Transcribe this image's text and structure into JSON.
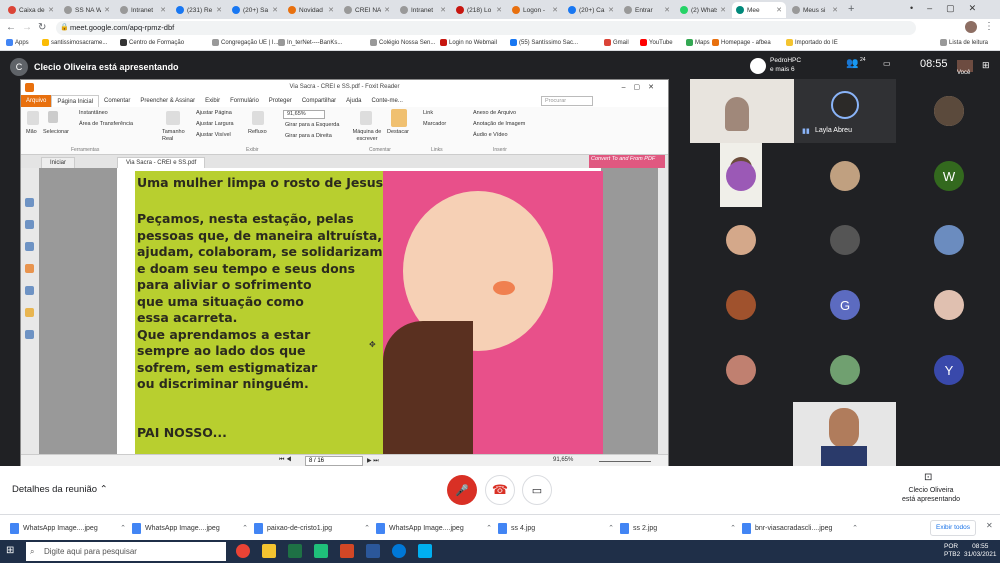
{
  "browser": {
    "tabs": [
      {
        "label": "Caixa de",
        "color": "#db4437"
      },
      {
        "label": "SS NA W",
        "color": "#999999"
      },
      {
        "label": "Intranet",
        "color": "#999999"
      },
      {
        "label": "(231) Re",
        "color": "#1877f2"
      },
      {
        "label": "(20+) Sa",
        "color": "#1877f2"
      },
      {
        "label": "Novidad",
        "color": "#e8700e"
      },
      {
        "label": "CREI NA",
        "color": "#999999"
      },
      {
        "label": "Intranet",
        "color": "#999999"
      },
      {
        "label": "(218) Lo",
        "color": "#c71610"
      },
      {
        "label": "Logon -",
        "color": "#e8700e"
      },
      {
        "label": "(20+) Ca",
        "color": "#1877f2"
      },
      {
        "label": "Entrar",
        "color": "#999999"
      },
      {
        "label": "(2) Whats",
        "color": "#25d366"
      },
      {
        "label": "Mee",
        "color": "#00897b",
        "active": true
      },
      {
        "label": "Meus si",
        "color": "#999999"
      }
    ],
    "url": "meet.google.com/apq-rpmz-dbf",
    "bookmarks": [
      "Apps",
      "santissimosacrame...",
      "Centro de Formação",
      "Congregação UE | I...",
      "In_terNet----BanKs...",
      "Colégio Nossa Sen...",
      "Login no Webmail",
      "(55) Santíssimo Sac...",
      "Gmail",
      "YouTube",
      "Maps",
      "Homepage - afbea",
      "Importado do IE",
      "Lista de leitura"
    ]
  },
  "meet": {
    "presenter_initial": "C",
    "presenter_text": "Clecio Oliveira está apresentando",
    "top_right_name": "PedroHPC",
    "top_right_more": "e mais 6",
    "participants_count": "24",
    "time": "08:55",
    "you_label": "Você",
    "speaker_name": "Layla Abreu",
    "meeting_details": "Detalhes da reunião",
    "presenting_name": "Clecio Oliveira",
    "presenting_label": "está apresentando",
    "participants": [
      {
        "kind": "photo",
        "color": "#c8b8a0"
      },
      {
        "kind": "photo",
        "color": "#5b4a3c"
      },
      {
        "kind": "photo",
        "color": "#9b59b6"
      },
      {
        "kind": "photo",
        "color": "#c0a080"
      },
      {
        "kind": "letter",
        "letter": "W",
        "color": "#33691e"
      },
      {
        "kind": "photo",
        "color": "#d4a88a"
      },
      {
        "kind": "photo",
        "color": "#555555"
      },
      {
        "kind": "photo",
        "color": "#6b8cbf"
      },
      {
        "kind": "photo",
        "color": "#a0522d"
      },
      {
        "kind": "letter",
        "letter": "G",
        "color": "#5c6bc0"
      },
      {
        "kind": "photo",
        "color": "#e0c0b0"
      },
      {
        "kind": "photo",
        "color": "#c08070"
      },
      {
        "kind": "photo",
        "color": "#70a070"
      },
      {
        "kind": "letter",
        "letter": "Y",
        "color": "#3949ab"
      }
    ]
  },
  "foxit": {
    "title": "Via Sacra - CREI e SS.pdf - Foxit Reader",
    "menu": [
      "Arquivo",
      "Página Inicial",
      "Comentar",
      "Preencher & Assinar",
      "Exibir",
      "Formulário",
      "Proteger",
      "Compartilhar",
      "Ajuda",
      "Conte-me..."
    ],
    "search_placeholder": "Procurar",
    "ribbon": {
      "mao": "Mão",
      "selecionar": "Selecionar",
      "instantaneo": "Instantâneo",
      "area": "Área de Transferência",
      "ferramentas": "Ferramentas",
      "tamanho": "Tamanho Real",
      "ajustar_pagina": "Ajustar Página",
      "ajustar_largura": "Ajustar Largura",
      "ajustar_visivel": "Ajustar Visível",
      "refluxo": "Refluxo",
      "zoom": "91,65%",
      "girar_esq": "Girar para a Esquerda",
      "girar_dir": "Girar para a Direita",
      "exibir": "Exibir",
      "maquina": "Máquina de escrever",
      "destacar": "Destacar",
      "comentar": "Comentar",
      "link": "Link",
      "marcador": "Marcador",
      "links": "Links",
      "anexo": "Anexo de Arquivo",
      "anotacao": "Anotação de Imagem",
      "audio": "Áudio e Vídeo",
      "inserir": "Inserir"
    },
    "doc_tabs": [
      "Iniciar",
      "Via Sacra - CREI e SS.pdf"
    ],
    "convert": "Convert To and From PDF",
    "page_indicator": "8 / 16",
    "zoom_status": "91,65%"
  },
  "pdf_page": {
    "heading": "Uma mulher limpa o rosto de Jesus",
    "lines": [
      "Peçamos, nesta estação, pelas",
      "pessoas que, de maneira altruísta,",
      "ajudam, colaboram, se solidarizam",
      "e doam seu tempo e seus dons",
      "para aliviar o sofrimento",
      "que uma situação como",
      "essa acarreta.",
      "Que aprendamos a estar",
      "sempre ao lado dos que",
      "sofrem, sem estigmatizar",
      "ou discriminar ninguém."
    ],
    "closing": "PAI NOSSO..."
  },
  "downloads": {
    "items": [
      "WhatsApp Image....jpeg",
      "WhatsApp Image....jpeg",
      "paixao-de-cristo1.jpg",
      "WhatsApp Image....jpeg",
      "ss 4.jpg",
      "ss 2.jpg",
      "bnr-viasacradascli....jpeg"
    ],
    "show_all": "Exibir todos"
  },
  "taskbar": {
    "search_placeholder": "Digite aqui para pesquisar",
    "lang": "POR",
    "lang2": "PTB2",
    "time": "08:55",
    "date": "31/03/2021"
  }
}
